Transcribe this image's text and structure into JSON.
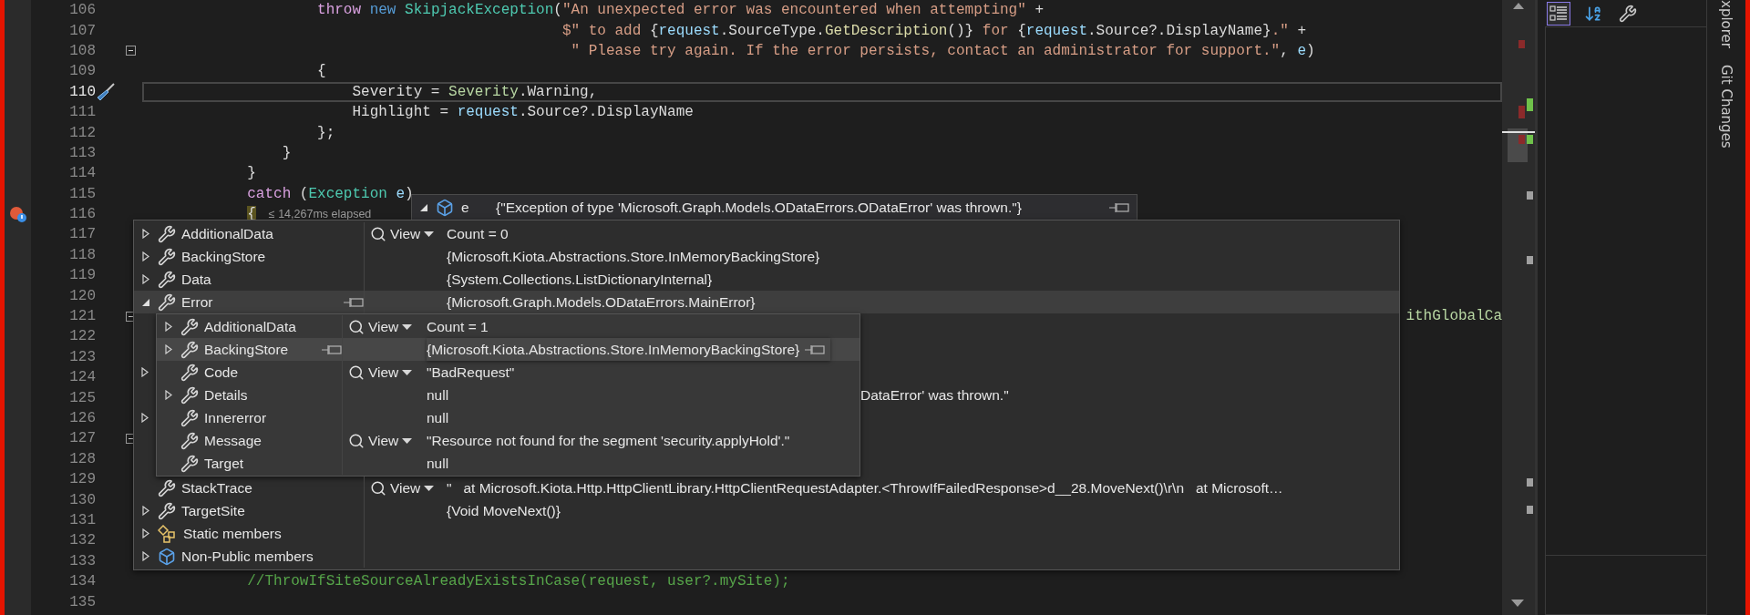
{
  "lines": [
    {
      "number": "106",
      "current": false,
      "tokens": [
        {
          "text": "                    throw",
          "kind": "control"
        },
        {
          "text": " new",
          "kind": "keyword"
        },
        {
          "text": " SkipjackException",
          "kind": "type"
        },
        {
          "text": "(",
          "kind": "plain"
        },
        {
          "text": "\"An unexpected error was encountered when attempting\"",
          "kind": "string"
        },
        {
          "text": " +",
          "kind": "plain"
        }
      ]
    },
    {
      "number": "107",
      "current": false,
      "tokens": [
        {
          "text": "                                                $\" to add ",
          "kind": "string"
        },
        {
          "text": "{",
          "kind": "plain"
        },
        {
          "text": "request",
          "kind": "param"
        },
        {
          "text": ".SourceType.",
          "kind": "plain"
        },
        {
          "text": "GetDescription",
          "kind": "method"
        },
        {
          "text": "()}",
          "kind": "plain"
        },
        {
          "text": " for ",
          "kind": "string"
        },
        {
          "text": "{",
          "kind": "plain"
        },
        {
          "text": "request",
          "kind": "param"
        },
        {
          "text": ".Source?.DisplayName}",
          "kind": "plain"
        },
        {
          "text": ".\"",
          "kind": "string"
        },
        {
          "text": " +",
          "kind": "plain"
        }
      ]
    },
    {
      "number": "108",
      "current": false,
      "markers": [
        {
          "kind": "collapse"
        }
      ],
      "tokens": [
        {
          "text": "                                                 \" Please try again. If the error persists, contact an administrator for support.\"",
          "kind": "string"
        },
        {
          "text": ", ",
          "kind": "plain"
        },
        {
          "text": "e",
          "kind": "param"
        },
        {
          "text": ")",
          "kind": "plain"
        }
      ]
    },
    {
      "number": "109",
      "current": false,
      "tokens": [
        {
          "text": "                    {",
          "kind": "plain"
        }
      ]
    },
    {
      "number": "110",
      "current": true,
      "markers": [
        {
          "kind": "quick_action"
        }
      ],
      "tokens": [
        {
          "text": "                        Severity = ",
          "kind": "plain"
        },
        {
          "text": "Severity",
          "kind": "enum"
        },
        {
          "text": ".Warning,",
          "kind": "plain"
        }
      ]
    },
    {
      "number": "111",
      "current": false,
      "tokens": [
        {
          "text": "                        Highlight = ",
          "kind": "plain"
        },
        {
          "text": "request",
          "kind": "param"
        },
        {
          "text": ".Source?.DisplayName",
          "kind": "plain"
        }
      ]
    },
    {
      "number": "112",
      "current": false,
      "tokens": [
        {
          "text": "                    };",
          "kind": "plain"
        }
      ]
    },
    {
      "number": "113",
      "current": false,
      "tokens": [
        {
          "text": "                }",
          "kind": "plain"
        }
      ]
    },
    {
      "number": "114",
      "current": false,
      "tokens": [
        {
          "text": "            }",
          "kind": "plain"
        }
      ]
    },
    {
      "number": "115",
      "current": false,
      "tokens": [
        {
          "text": "            catch",
          "kind": "control"
        },
        {
          "text": " (",
          "kind": "plain"
        },
        {
          "text": "Exception",
          "kind": "type"
        },
        {
          "text": " e",
          "kind": "param"
        },
        {
          "text": ")",
          "kind": "plain"
        }
      ]
    },
    {
      "number": "116",
      "current": false,
      "markers": [
        {
          "kind": "exception"
        }
      ],
      "tokens": [
        {
          "text": "            {",
          "kind": "brace"
        }
      ],
      "perf_tip": "≤ 14,267ms elapsed"
    },
    {
      "number": "117",
      "current": false
    },
    {
      "number": "118",
      "current": false
    },
    {
      "number": "119",
      "current": false
    },
    {
      "number": "120",
      "current": false
    },
    {
      "number": "121",
      "current": false,
      "markers": [
        {
          "kind": "collapse"
        }
      ],
      "tail": "ithGlobalCa"
    },
    {
      "number": "122",
      "current": false
    },
    {
      "number": "123",
      "current": false
    },
    {
      "number": "124",
      "current": false
    },
    {
      "number": "125",
      "current": false
    },
    {
      "number": "126",
      "current": false
    },
    {
      "number": "127",
      "current": false,
      "markers": [
        {
          "kind": "collapse"
        }
      ]
    },
    {
      "number": "128",
      "current": false
    },
    {
      "number": "129",
      "current": false
    },
    {
      "number": "130",
      "current": false
    },
    {
      "number": "131",
      "current": false
    },
    {
      "number": "132",
      "current": false
    },
    {
      "number": "133",
      "current": false
    },
    {
      "number": "134",
      "current": false,
      "tokens": [
        {
          "text": "            //ThrowIfSiteSourceAlreadyExistsInCase(request, user?.mySite);",
          "kind": "comment"
        }
      ]
    },
    {
      "number": "135",
      "current": false
    }
  ],
  "datatip": {
    "header": {
      "expanded": true,
      "name": "e",
      "value": "{\"Exception of type 'Microsoft.Graph.Models.ODataErrors.ODataError' was thrown.\"}"
    },
    "rows": [
      {
        "name": "AdditionalData",
        "kind": "property",
        "expanded": false,
        "view": "View",
        "value": "Count = 0",
        "selected": false
      },
      {
        "name": "BackingStore",
        "kind": "property",
        "expanded": false,
        "value": "{Microsoft.Kiota.Abstractions.Store.InMemoryBackingStore}",
        "selected": false
      },
      {
        "name": "Data",
        "kind": "property",
        "expanded": false,
        "value": "{System.Collections.ListDictionaryInternal}",
        "selected": false
      },
      {
        "name": "Error",
        "kind": "property",
        "expanded": true,
        "value": "{Microsoft.Graph.Models.ODataErrors.MainError}",
        "selected": true,
        "children": [
          {
            "name": "AdditionalData",
            "kind": "property",
            "expanded": false,
            "view": "View",
            "value": "Count = 1",
            "selected": false
          },
          {
            "name": "BackingStore",
            "kind": "property",
            "expanded": false,
            "value": "{Microsoft.Kiota.Abstractions.Store.InMemoryBackingStore}",
            "selected": true
          },
          {
            "name": "Code",
            "kind": "property",
            "view": "View",
            "value": "\"BadRequest\"",
            "selected": false
          },
          {
            "name": "Details",
            "kind": "property",
            "expanded": false,
            "value": "null",
            "selected": false
          },
          {
            "name": "Innererror",
            "kind": "property",
            "value": "null",
            "selected": false
          },
          {
            "name": "Message",
            "kind": "property",
            "view": "View",
            "value": "\"Resource not found for the segment 'security.applyHold'.\"",
            "selected": false
          },
          {
            "name": "Target",
            "kind": "property",
            "value": "null",
            "selected": false
          }
        ],
        "covered_rows": [
          {
            "kind": "blank"
          },
          {
            "kind": "blank"
          },
          {
            "kind": "collapsed"
          },
          {
            "kind": "value",
            "value": "DataError' was thrown.\""
          },
          {
            "kind": "collapsed"
          },
          {
            "kind": "blank"
          },
          {
            "kind": "blank"
          }
        ]
      },
      {
        "name": "StackTrace",
        "kind": "property",
        "view": "View",
        "value": "\"   at Microsoft.Kiota.Http.HttpClientLibrary.HttpClientRequestAdapter.<ThrowIfFailedResponse>d__28.MoveNext()\\r\\n   at Microsoft…",
        "selected": false
      },
      {
        "name": "TargetSite",
        "kind": "property",
        "expanded": false,
        "value": "{Void MoveNext()}",
        "selected": false
      },
      {
        "name": "Static members",
        "kind": "static",
        "expanded": false,
        "selected": false
      },
      {
        "name": "Non-Public members",
        "kind": "nonpublic",
        "expanded": false,
        "selected": false
      }
    ]
  },
  "properties_toolbar": [
    {
      "kind": "categorized",
      "selected": true
    },
    {
      "kind": "alphabetical",
      "selected": false
    },
    {
      "kind": "property_pages",
      "selected": false
    }
  ],
  "side_tabs": [
    {
      "label": "xplorer"
    },
    {
      "label": "Git Changes"
    }
  ]
}
